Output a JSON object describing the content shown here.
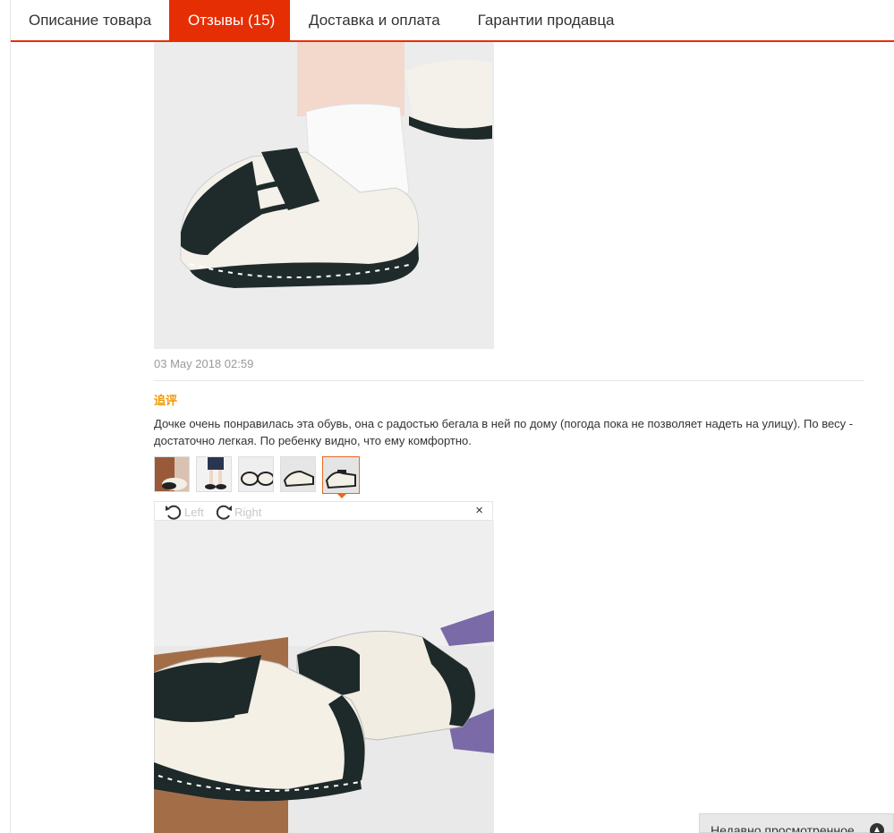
{
  "tabs": [
    {
      "label": "Описание товара",
      "active": false
    },
    {
      "label": "Отзывы (15)",
      "active": true
    },
    {
      "label": "Доставка и оплата",
      "active": false
    },
    {
      "label": "Гарантии продавца",
      "active": false
    }
  ],
  "review": {
    "date": "03 May 2018 02:59",
    "followup_label": "追评",
    "text": "Дочке очень понравилась эта обувь, она с радостью бегала в ней по дому (погода пока не позволяет надеть на улицу). По весу - достаточно легкая. По ребенку видно, что ему комфортно.",
    "thumbnails_count": 5,
    "active_thumbnail": 5
  },
  "viewer": {
    "rotate_left_label": "Left",
    "rotate_right_label": "Right",
    "close_label": "×"
  },
  "recently_viewed": {
    "label": "Недавно просмотренное"
  },
  "colors": {
    "accent": "#e62e04",
    "followup": "#f39800",
    "thumb_active": "#e66a1e"
  }
}
